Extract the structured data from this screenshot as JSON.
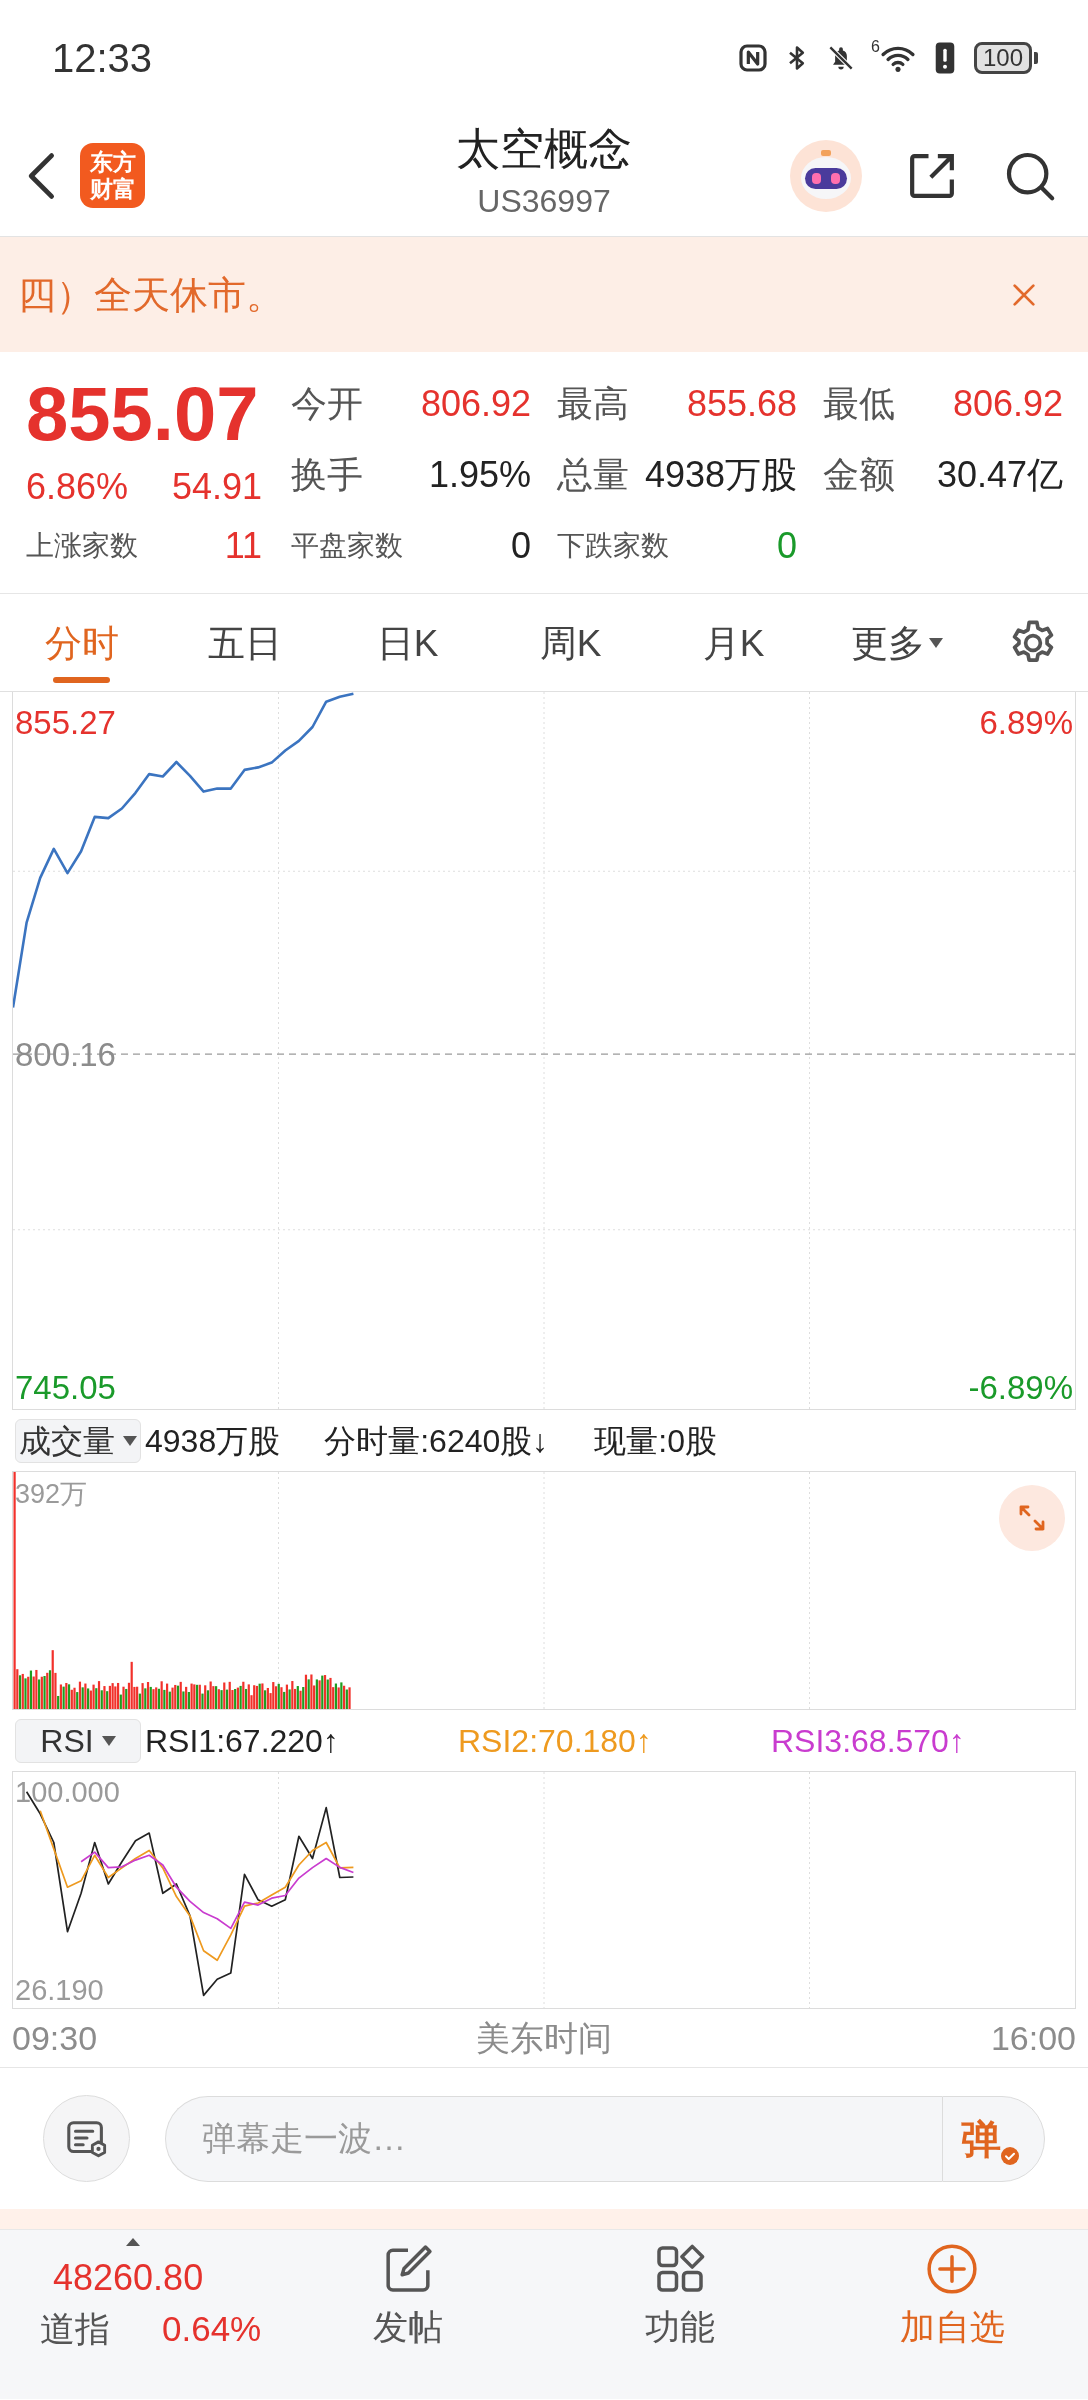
{
  "status_bar": {
    "time": "12:33",
    "network_label": "6",
    "battery": "100"
  },
  "header": {
    "logo_lines": [
      "东方",
      "财富"
    ],
    "title": "太空概念",
    "code": "US36997"
  },
  "notice": {
    "text": "四）全天休市。"
  },
  "quote": {
    "price": "855.07",
    "change_pct": "6.86%",
    "change": "54.91",
    "rising": true,
    "stats": [
      {
        "label": "今开",
        "value": "806.92",
        "color": "#e5322d"
      },
      {
        "label": "最高",
        "value": "855.68",
        "color": "#e5322d"
      },
      {
        "label": "最低",
        "value": "806.92",
        "color": "#e5322d"
      },
      {
        "label": "换手",
        "value": "1.95%",
        "color": "#222222"
      },
      {
        "label": "总量",
        "value": "4938万股",
        "color": "#222222"
      },
      {
        "label": "金额",
        "value": "30.47亿",
        "color": "#222222"
      }
    ],
    "breadth": [
      {
        "label": "上涨家数",
        "value": "11",
        "color": "#e5322d"
      },
      {
        "label": "平盘家数",
        "value": "0",
        "color": "#222222"
      },
      {
        "label": "下跌家数",
        "value": "0",
        "color": "#1a9a2a"
      }
    ]
  },
  "tabs": [
    {
      "label": "分时",
      "selected": true,
      "dropdown": false
    },
    {
      "label": "五日",
      "selected": false,
      "dropdown": false
    },
    {
      "label": "日K",
      "selected": false,
      "dropdown": false
    },
    {
      "label": "周K",
      "selected": false,
      "dropdown": false
    },
    {
      "label": "月K",
      "selected": false,
      "dropdown": false
    },
    {
      "label": "更多",
      "selected": false,
      "dropdown": true
    }
  ],
  "price_chart": {
    "right_labels": [
      {
        "text": "6.89%",
        "color": "#e5322d"
      },
      {
        "text": "-6.89%",
        "color": "#1a9a2a"
      }
    ],
    "chart_data": {
      "type": "line",
      "categories": [
        null,
        null,
        null,
        null,
        null,
        null,
        null,
        null,
        null,
        null,
        null,
        null,
        null,
        null,
        null,
        null,
        null,
        null,
        null,
        null,
        null,
        null,
        null,
        null,
        null,
        null,
        null,
        null,
        null,
        null,
        null,
        null,
        null,
        null,
        null,
        null,
        null,
        null,
        null,
        null,
        null,
        null,
        null,
        null,
        null,
        null,
        null,
        null,
        null,
        null,
        null,
        null,
        null,
        null,
        null,
        null,
        null,
        null,
        null,
        null,
        null,
        null,
        null,
        null,
        null,
        null,
        null,
        null,
        null,
        null,
        null,
        null,
        null,
        null,
        null,
        null,
        null,
        null,
        null
      ],
      "series": [
        {
          "color": "#9a9a9a",
          "line_style": "dashed",
          "values": [
            800.2,
            800.2,
            800.2,
            800.2,
            800.2,
            800.2,
            800.2,
            800.2,
            800.2,
            800.2,
            800.2,
            800.2,
            800.2,
            800.2,
            800.2,
            800.2,
            800.2,
            800.2,
            800.2,
            800.2,
            800.2,
            800.2,
            800.2,
            800.2,
            800.2,
            800.2,
            800.2,
            800.2,
            800.2,
            800.2,
            800.2,
            800.2,
            800.2,
            800.2,
            800.2,
            800.2,
            800.2,
            800.2,
            800.2,
            800.2,
            800.2,
            800.2,
            800.2,
            800.2,
            800.2,
            800.2,
            800.2,
            800.2,
            800.2,
            800.2,
            800.2,
            800.2,
            800.2,
            800.2,
            800.2,
            800.2,
            800.2,
            800.2,
            800.2,
            800.2,
            800.2,
            800.2,
            800.2,
            800.2,
            800.2,
            800.2,
            800.2,
            800.2,
            800.2,
            800.2,
            800.2,
            800.2,
            800.2,
            800.2,
            800.2,
            800.2,
            800.2,
            800.2,
            800.2
          ]
        },
        {
          "color": "#3b74c0",
          "values": [
            807.9,
            822,
            829.4,
            834.2,
            830.2,
            833.8,
            839.5,
            839.3,
            840.9,
            843.5,
            846.6,
            846.2,
            848.6,
            846.3,
            843.7,
            844.2,
            844.2,
            847.3,
            847.7,
            848.5,
            850.5,
            852.1,
            854.4,
            858.6,
            859.4,
            859.9,
            null,
            null,
            null,
            null,
            null,
            null,
            null,
            null,
            null,
            null,
            null,
            null,
            null,
            null,
            null,
            null,
            null,
            null,
            null,
            null,
            null,
            null,
            null,
            null,
            null,
            null,
            null,
            null,
            null,
            null,
            null,
            null,
            null,
            null,
            null,
            null,
            null,
            null,
            null,
            null,
            null,
            null,
            null,
            null,
            null,
            null,
            null,
            null,
            null,
            null,
            null,
            null,
            null
          ]
        }
      ],
      "ylim": [
        741.4,
        860.2
      ],
      "yticks": [
        {
          "value": 855.27,
          "label": "855.27"
        },
        {
          "value": 800.16,
          "label": "800.16"
        },
        {
          "value": 745.05,
          "label": "745.05"
        }
      ]
    }
  },
  "volume_panel": {
    "indicator": "成交量",
    "total": "4938万股",
    "interval_volume": "分时量:6240股↓",
    "current_volume": "现量:0股",
    "max_label": "392万"
  },
  "rsi_panel": {
    "indicator": "RSI",
    "readings": [
      {
        "text": "RSI1:67.220↑",
        "color": "#222222"
      },
      {
        "text": "RSI2:70.180↑",
        "color": "#ee9a1f"
      },
      {
        "text": "RSI3:68.570↑",
        "color": "#c93ccf"
      }
    ],
    "chart_data": {
      "type": "line",
      "categories": [
        null,
        null,
        null,
        null,
        null,
        null,
        null,
        null,
        null,
        null,
        null,
        null,
        null,
        null,
        null,
        null,
        null,
        null,
        null,
        null,
        null,
        null,
        null,
        null,
        null,
        null,
        null,
        null,
        null,
        null,
        null,
        null,
        null,
        null,
        null,
        null,
        null,
        null,
        null,
        null,
        null,
        null,
        null,
        null,
        null,
        null,
        null,
        null,
        null,
        null,
        null,
        null,
        null,
        null,
        null,
        null,
        null,
        null,
        null,
        null,
        null,
        null,
        null,
        null,
        null,
        null,
        null,
        null,
        null,
        null,
        null,
        null,
        null,
        null,
        null,
        null,
        null,
        null,
        null
      ],
      "ylim": [
        19.3,
        107.4
      ],
      "yticks": [
        {
          "value": 100,
          "label": "100.000"
        },
        {
          "value": 26.19,
          "label": "26.190"
        }
      ],
      "series": [
        {
          "color": "#222222",
          "values": [
            null,
            100,
            91.8,
            81.1,
            47.8,
            62.1,
            81.1,
            65.6,
            73.9,
            81.7,
            84.6,
            62.1,
            65.6,
            53.7,
            24,
            30,
            32.4,
            69.2,
            59.7,
            57.3,
            59.7,
            83.4,
            75.1,
            94.1,
            68,
            68.2,
            null,
            null,
            null,
            null,
            null,
            null,
            null,
            null,
            null,
            null,
            null,
            null,
            null,
            null,
            null,
            null,
            null,
            null,
            null,
            null,
            null,
            null,
            null,
            null,
            null,
            null,
            null,
            null,
            null,
            null,
            null,
            null,
            null,
            null,
            null,
            null,
            null,
            null,
            null,
            null,
            null,
            null,
            null,
            null,
            null,
            null,
            null,
            null,
            null,
            null,
            null,
            null,
            null
          ]
        },
        {
          "color": "#ee9a1f",
          "values": [
            null,
            null,
            92.9,
            78.7,
            64.4,
            66.8,
            76.3,
            68,
            71.6,
            75.1,
            78.1,
            71.6,
            60.9,
            53.7,
            40.7,
            37.1,
            46.6,
            57.3,
            58.5,
            61.5,
            64.4,
            72.7,
            78.1,
            81.1,
            71.6,
            71.8,
            null,
            null,
            null,
            null,
            null,
            null,
            null,
            null,
            null,
            null,
            null,
            null,
            null,
            null,
            null,
            null,
            null,
            null,
            null,
            null,
            null,
            null,
            null,
            null,
            null,
            null,
            null,
            null,
            null,
            null,
            null,
            null,
            null,
            null,
            null,
            null,
            null,
            null,
            null,
            null,
            null,
            null,
            null,
            null,
            null,
            null,
            null,
            null,
            null,
            null,
            null,
            null,
            null
          ]
        },
        {
          "color": "#c93ccf",
          "values": [
            null,
            null,
            null,
            null,
            null,
            73.9,
            77.5,
            71.7,
            72,
            74.5,
            76.3,
            72.7,
            64.4,
            59.1,
            54.9,
            52.6,
            49,
            58.8,
            57.7,
            60.3,
            61.3,
            67.8,
            71.7,
            75.1,
            71.8,
            69.9,
            null,
            null,
            null,
            null,
            null,
            null,
            null,
            null,
            null,
            null,
            null,
            null,
            null,
            null,
            null,
            null,
            null,
            null,
            null,
            null,
            null,
            null,
            null,
            null,
            null,
            null,
            null,
            null,
            null,
            null,
            null,
            null,
            null,
            null,
            null,
            null,
            null,
            null,
            null,
            null,
            null,
            null,
            null,
            null,
            null,
            null,
            null,
            null,
            null,
            null,
            null,
            null,
            null
          ]
        }
      ]
    }
  },
  "time_axis": {
    "start": "09:30",
    "title": "美东时间",
    "end": "16:00"
  },
  "comment_bar": {
    "placeholder": "弹幕走一波…",
    "send_label": "弹"
  },
  "bottom_nav": {
    "index": {
      "value": "48260.80",
      "name": "道指",
      "change": "0.64%",
      "rising": true
    },
    "items": [
      {
        "kind": "post",
        "label": "发帖",
        "accent": false
      },
      {
        "kind": "apps",
        "label": "功能",
        "accent": false
      },
      {
        "kind": "add",
        "label": "加自选",
        "accent": true
      }
    ]
  }
}
